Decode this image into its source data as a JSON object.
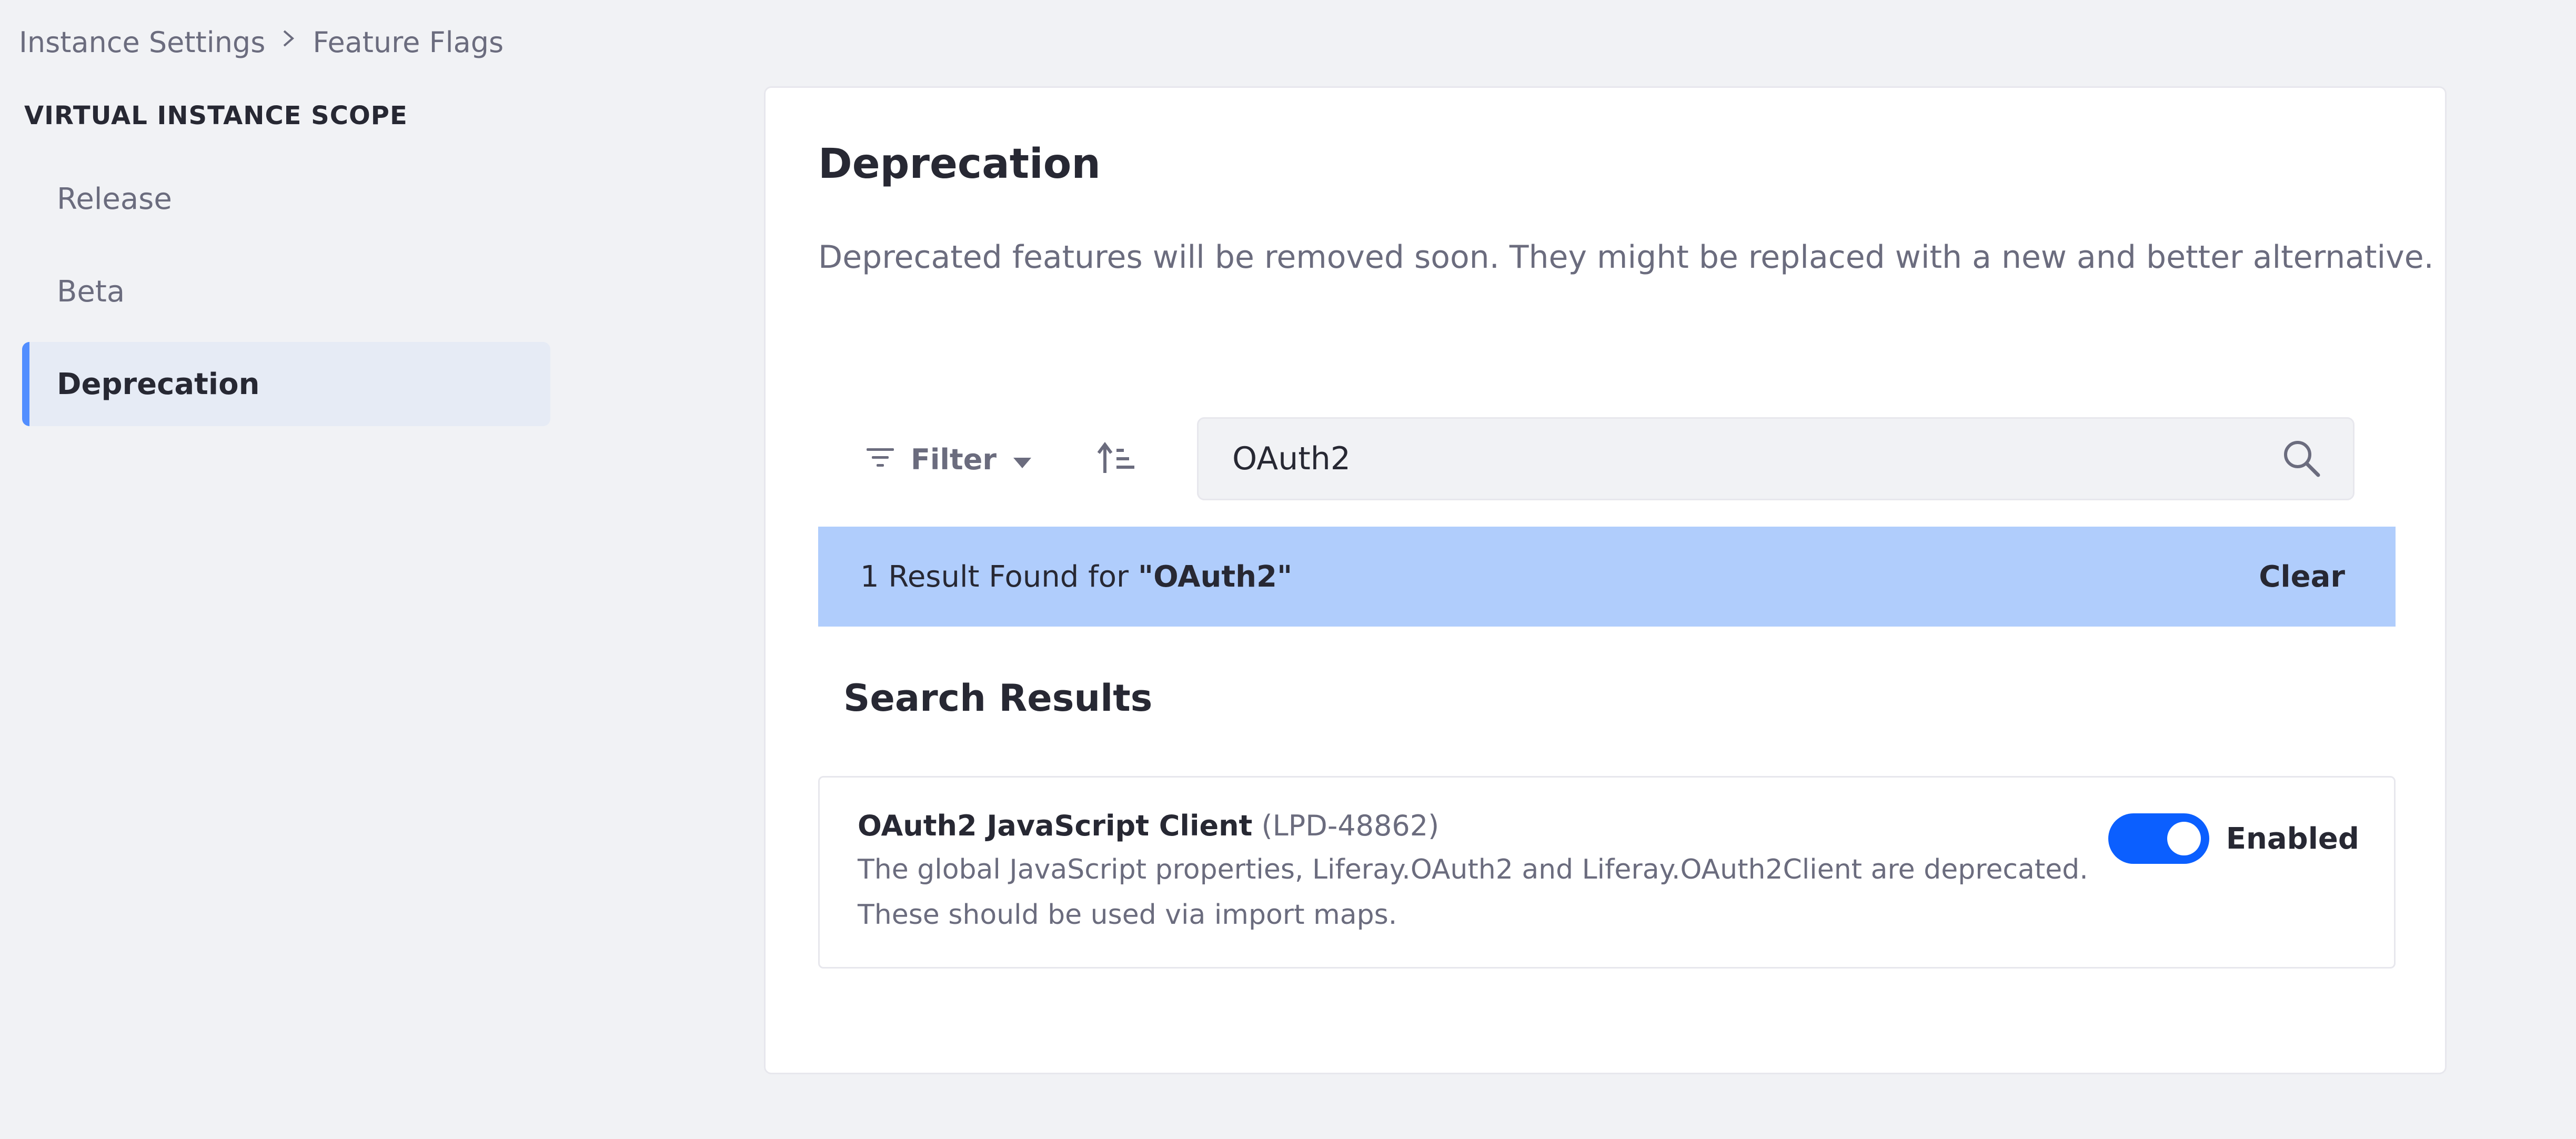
{
  "breadcrumb": {
    "items": [
      "Instance Settings",
      "Feature Flags"
    ]
  },
  "sidebar": {
    "heading": "VIRTUAL INSTANCE SCOPE",
    "items": [
      {
        "label": "Release"
      },
      {
        "label": "Beta"
      },
      {
        "label": "Deprecation",
        "active": true
      }
    ]
  },
  "main": {
    "title": "Deprecation",
    "description": "Deprecated features will be removed soon. They might be replaced with a new and better alternative.",
    "toolbar": {
      "filter_label": "Filter"
    },
    "search": {
      "value": "OAuth2"
    },
    "results_banner": {
      "prefix": "1 Result Found for",
      "query": "\"OAuth2\"",
      "clear_label": "Clear"
    },
    "section_title": "Search Results",
    "flags": [
      {
        "title": "OAuth2 JavaScript Client",
        "id": "(LPD-48862)",
        "description_line1": "The global JavaScript properties, Liferay.OAuth2 and Liferay.OAuth2Client are deprecated.",
        "description_line2": "These should be used via import maps.",
        "toggle_label": "Enabled",
        "enabled": true
      }
    ]
  },
  "colors": {
    "accent": "#0b5fff",
    "active_bar": "#528eff",
    "banner": "#b0cdfc",
    "page_bg": "#f1f2f5"
  },
  "icons": [
    "chevron-right-icon",
    "filter-icon",
    "caret-down-icon",
    "sort-ascending-icon",
    "search-icon"
  ]
}
